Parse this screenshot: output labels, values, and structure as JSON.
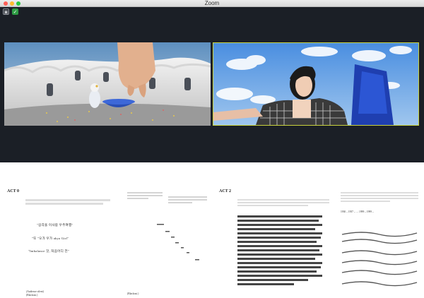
{
  "window": {
    "title": "Zoom"
  },
  "toolbar_icons": [
    {
      "name": "view-icon",
      "glyph": "▣"
    },
    {
      "name": "shield-icon",
      "glyph": "✓"
    }
  ],
  "colors": {
    "active_speaker_border": "#c9d23c",
    "background": "#1b1f26"
  },
  "document": {
    "act0": "ACT 0",
    "act2": "ACT 2",
    "handwriting": {
      "line1": "\"삼각을 이사람 우주여행\"",
      "line2": "\"또 \"오가 우가 ahya Girl\"",
      "line3": "\"Imbalance 것, 처음어디 전\""
    },
    "notes": {
      "audience_silent": "(Audience silent)",
      "blackout": "(Blackout.)",
      "blackout2": "(Blackout.)"
    },
    "timeline": "1930 – 1957 – … 1999 – 1999 –"
  }
}
